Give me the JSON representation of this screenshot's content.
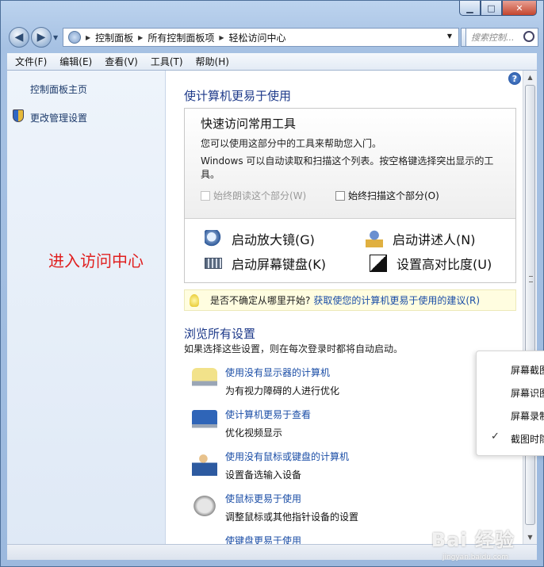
{
  "titlebar": {
    "min_glyph": "▁",
    "max_glyph": "□",
    "close_glyph": "✕"
  },
  "address": {
    "crumbs": [
      "控制面板",
      "所有控制面板项",
      "轻松访问中心"
    ],
    "search_placeholder": "搜索控制..."
  },
  "menubar": [
    "文件(F)",
    "编辑(E)",
    "查看(V)",
    "工具(T)",
    "帮助(H)"
  ],
  "sidebar": {
    "home_link": "控制面板主页",
    "admin_link": "更改管理设置",
    "annotation": "进入访问中心"
  },
  "main": {
    "title": "使计算机更易于使用",
    "quick": {
      "heading": "快速访问常用工具",
      "p1": "您可以使用这部分中的工具来帮助您入门。",
      "p2": "Windows 可以自动读取和扫描这个列表。按空格键选择突出显示的工具。",
      "cb_read": "始终朗读这个部分(W)",
      "cb_scan": "始终扫描这个部分(O)",
      "tools": [
        "启动放大镜(G)",
        "启动讲述人(N)",
        "启动屏幕键盘(K)",
        "设置高对比度(U)"
      ]
    },
    "tip": {
      "text": "是否不确定从哪里开始?",
      "link": "获取使您的计算机更易于使用的建议(R)"
    },
    "browse": {
      "heading": "浏览所有设置",
      "desc": "如果选择这些设置，则在每次登录时都将自动启动。",
      "items": [
        {
          "link": "使用没有显示器的计算机",
          "desc": "为有视力障碍的人进行优化",
          "icon": "monitor-speech-icon"
        },
        {
          "link": "使计算机更易于查看",
          "desc": "优化视频显示",
          "icon": "magnified-monitor-icon"
        },
        {
          "link": "使用没有鼠标或键盘的计算机",
          "desc": "设置备选输入设备",
          "icon": "user-icon"
        },
        {
          "link": "使鼠标更易于使用",
          "desc": "调整鼠标或其他指针设备的设置",
          "icon": "mouse-icon"
        },
        {
          "link": "使键盘更易于使用",
          "desc": "",
          "icon": "keyboard-icon"
        }
      ]
    }
  },
  "context_menu": {
    "items": [
      "屏幕截图",
      "屏幕识图",
      "屏幕录制",
      "截图时隐"
    ],
    "checked_index": 3
  },
  "watermark": {
    "brand": "Bai 经验",
    "url": "jingyan.baidu.com"
  }
}
